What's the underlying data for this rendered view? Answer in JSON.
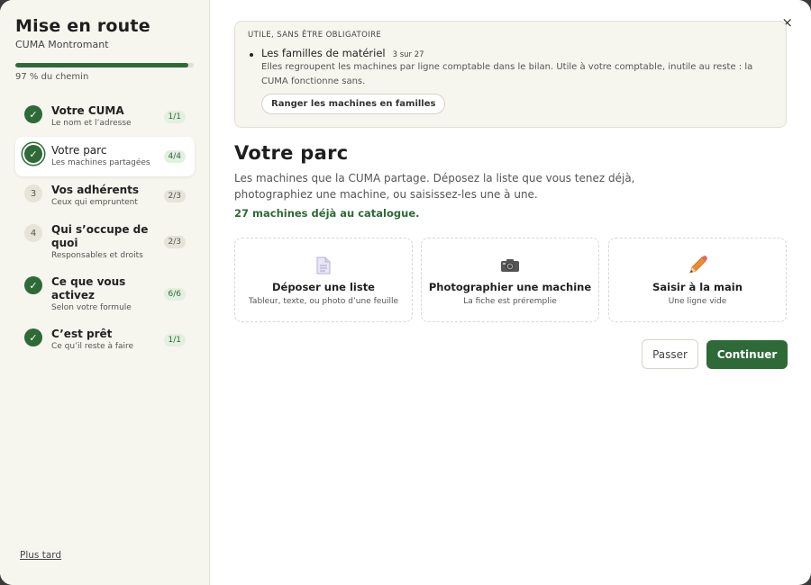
{
  "sidebar": {
    "title": "Mise en route",
    "org": "CUMA Montromant",
    "progress_percent": 97,
    "progress_label": "97 % du chemin",
    "steps": [
      {
        "title": "Votre CUMA",
        "desc": "Le nom et l’adresse",
        "badge": "1/1",
        "state": "done",
        "marker": "✓"
      },
      {
        "title": "Votre parc",
        "desc": "Les machines partagées",
        "badge": "4/4",
        "state": "active",
        "marker": "✓"
      },
      {
        "title": "Vos adhérents",
        "desc": "Ceux qui empruntent",
        "badge": "2/3",
        "state": "todo",
        "marker": "3"
      },
      {
        "title": "Qui s’occupe de quoi",
        "desc": "Responsables et droits",
        "badge": "2/3",
        "state": "todo",
        "marker": "4"
      },
      {
        "title": "Ce que vous activez",
        "desc": "Selon votre formule",
        "badge": "6/6",
        "state": "done",
        "marker": "✓"
      },
      {
        "title": "C’est prêt",
        "desc": "Ce qu’il reste à faire",
        "badge": "1/1",
        "state": "done",
        "marker": "✓"
      }
    ],
    "later_link": "Plus tard"
  },
  "main": {
    "close_icon": "×",
    "tip": {
      "kicker": "UTILE, SANS ÊTRE OBLIGATOIRE",
      "title": "Les familles de matériel",
      "count": "3 sur 27",
      "desc": "Elles regroupent les machines par ligne comptable dans le bilan. Utile à votre comptable, inutile au reste : la CUMA fonctionne sans.",
      "button": "Ranger les machines en familles"
    },
    "heading": "Votre parc",
    "lead": "Les machines que la CUMA partage. Déposez la liste que vous tenez déjà, photographiez une machine, ou saisissez-les une à une.",
    "catalog": "27 machines déjà au catalogue.",
    "cards": [
      {
        "icon": "document-icon",
        "title": "Déposer une liste",
        "desc": "Tableur, texte, ou photo d’une feuille"
      },
      {
        "icon": "camera-icon",
        "title": "Photographier une machine",
        "desc": "La fiche est préremplie"
      },
      {
        "icon": "pencil-icon",
        "title": "Saisir à la main",
        "desc": "Une ligne vide"
      }
    ],
    "skip_button": "Passer",
    "continue_button": "Continuer"
  },
  "colors": {
    "accent": "#2d6a37",
    "sidebar_bg": "#f6f5ee"
  }
}
